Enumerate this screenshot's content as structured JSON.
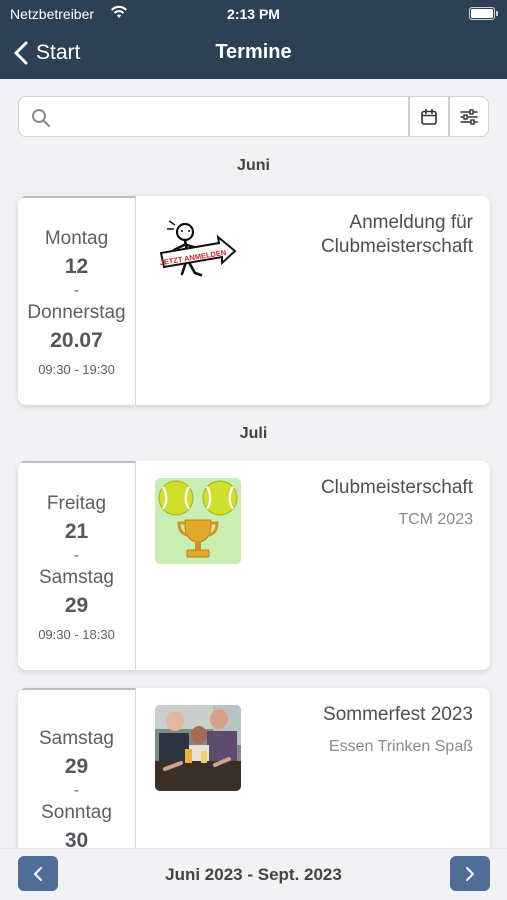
{
  "status": {
    "carrier": "Netzbetreiber",
    "time": "2:13 PM"
  },
  "nav": {
    "back_label": "Start",
    "title": "Termine"
  },
  "search": {
    "value": "",
    "placeholder": ""
  },
  "months": [
    "Juni",
    "Juli"
  ],
  "events": [
    {
      "day_from": "Montag",
      "date_from": "12",
      "dash": "-",
      "day_to": "Donnerstag",
      "date_to": "20.07",
      "hours": "09:30 - 19:30",
      "title": "Anmeldung für Clubmeisterschaft",
      "subtitle": "",
      "image": "stickman-sign-image",
      "image_text": "JETZT ANMELDEN"
    },
    {
      "day_from": "Freitag",
      "date_from": "21",
      "dash": "-",
      "day_to": "Samstag",
      "date_to": "29",
      "hours": "09:30 - 18:30",
      "title": "Clubmeisterschaft",
      "subtitle": "TCM 2023",
      "image": "tennis-trophy-image"
    },
    {
      "day_from": "Samstag",
      "date_from": "29",
      "dash": "-",
      "day_to": "Sonntag",
      "date_to": "30",
      "hours": "",
      "title": "Sommerfest 2023",
      "subtitle": "Essen Trinken Spaß",
      "image": "party-photo-image"
    }
  ],
  "footer": {
    "range": "Juni 2023 - Sept. 2023"
  },
  "colors": {
    "header": "#2e4154",
    "pager_button": "#4e6e98",
    "background": "#f2f2f4"
  }
}
